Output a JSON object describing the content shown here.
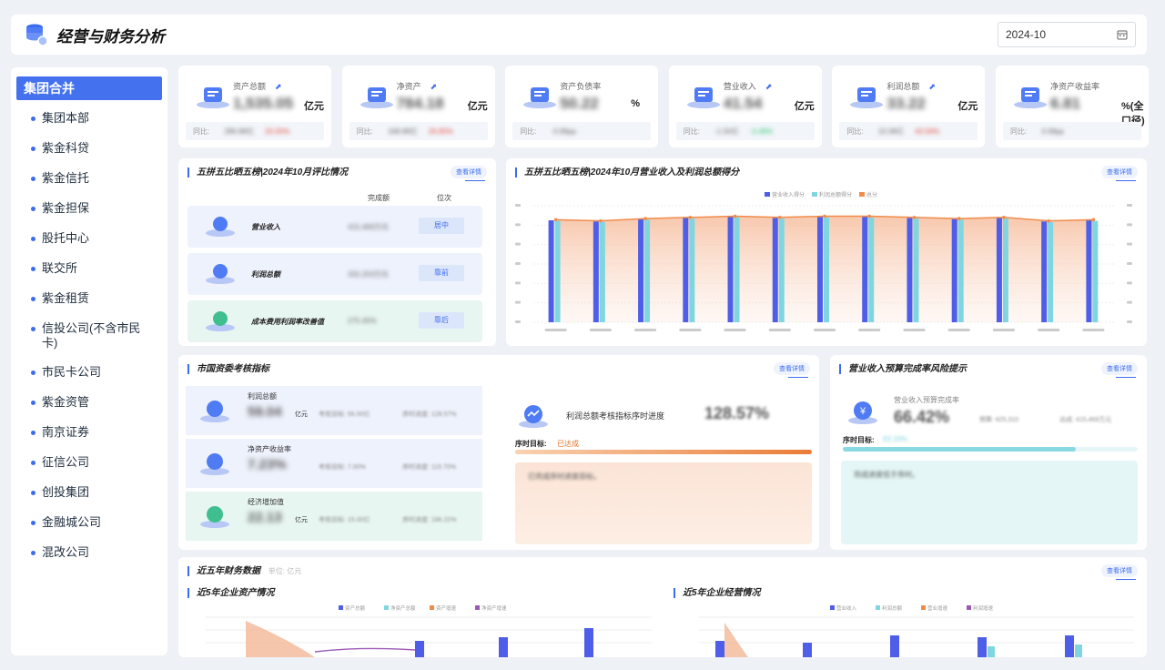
{
  "header": {
    "title": "经营与财务分析",
    "date": "2024-10"
  },
  "sidebar": {
    "active": "集团合并",
    "items": [
      "集团本部",
      "紫金科贷",
      "紫金信托",
      "紫金担保",
      "股托中心",
      "联交所",
      "紫金租赁",
      "信投公司(不含市民卡)",
      "市民卡公司",
      "紫金资管",
      "南京证券",
      "征信公司",
      "创投集团",
      "金融城公司",
      "混改公司"
    ]
  },
  "kpis": [
    {
      "label": "资产总额",
      "value": "1,535.05",
      "unit": "亿元",
      "yoy_label": "同比:",
      "yoy": "286.88亿",
      "rate": "20.05%",
      "dir": "up"
    },
    {
      "label": "净资产",
      "value": "784.18",
      "unit": "亿元",
      "yoy_label": "同比:",
      "yoy": "168.88亿",
      "rate": "26.85%",
      "dir": "up"
    },
    {
      "label": "资产负债率",
      "value": "50.22",
      "unit": "%",
      "yoy_label": "同比:",
      "yoy": "-0.89pp",
      "rate": "",
      "dir": ""
    },
    {
      "label": "营业收入",
      "value": "41.54",
      "unit": "亿元",
      "yoy_label": "同比:",
      "yoy": "-1.50亿",
      "rate": "-3.48%",
      "dir": "down"
    },
    {
      "label": "利润总额",
      "value": "33.22",
      "unit": "亿元",
      "yoy_label": "同比:",
      "yoy": "10.08亿",
      "rate": "43.56%",
      "dir": "up"
    },
    {
      "label": "净资产收益率",
      "value": "6.81",
      "unit": "%(全口径)",
      "yoy_label": "同比:",
      "yoy": "0.68pp",
      "rate": "",
      "dir": ""
    }
  ],
  "rank": {
    "title": "五拼五比晒五榜|2024年10月评比情况",
    "more": "查看详情",
    "col_done": "完成额",
    "col_rank": "位次",
    "rows": [
      {
        "label": "营业收入",
        "value": "415,469万元",
        "badge": "居中"
      },
      {
        "label": "利润总额",
        "value": "332,203万元",
        "badge": "靠前"
      },
      {
        "label": "成本费用利润率改善值",
        "value": "275.45%",
        "badge": "靠后"
      }
    ]
  },
  "score": {
    "title": "五拼五比晒五榜|2024年10月营业收入及利润总额得分",
    "more": "查看详情",
    "legend": [
      "营业收入得分",
      "利润总额得分",
      "总分"
    ]
  },
  "sasac": {
    "title": "市国资委考核指标",
    "more": "查看详情",
    "rows": [
      {
        "label": "利润总额",
        "value": "59.04",
        "unit": "亿元",
        "target": "考核目标: 56.00亿",
        "progress": "序时进度: 128.57%"
      },
      {
        "label": "净资产收益率",
        "value": "7.23%",
        "unit": "",
        "target": "考核目标: 7.00%",
        "progress": "序时进度: 115.70%"
      },
      {
        "label": "经济增加值",
        "value": "22.13",
        "unit": "亿元",
        "target": "考核目标: 15.00亿",
        "progress": "序时进度: 186.22%"
      }
    ],
    "progress_title": "利润总额考核指标序时进度",
    "progress_value": "128.57%",
    "target_label": "序时目标:",
    "target_status": "已达成",
    "note": "已完成序时进度目标。"
  },
  "risk": {
    "title": "营业收入预算完成率风险提示",
    "more": "查看详情",
    "label": "营业收入预算完成率",
    "value": "66.42%",
    "budget": "预算: 625,310",
    "actual": "达成: 415,469万元",
    "target_label": "序时目标:",
    "target": "83.33%",
    "note": "完成进度低于序时。"
  },
  "fiveyr": {
    "title": "近五年财务数据",
    "subtitle": "单位: 亿元",
    "more": "查看详情",
    "left_title": "近5年企业资产情况",
    "left_legend": [
      "资产总额",
      "净资产总额",
      "资产增速",
      "净资产增速"
    ],
    "right_title": "近5年企业经营情况",
    "right_legend": [
      "营业收入",
      "利润总额",
      "营业增速",
      "利润增速"
    ]
  },
  "colors": {
    "accent": "#3b6cf0",
    "bar1": "#4f5ee8",
    "bar2": "#7fd6e0",
    "line": "#f08c4a"
  }
}
